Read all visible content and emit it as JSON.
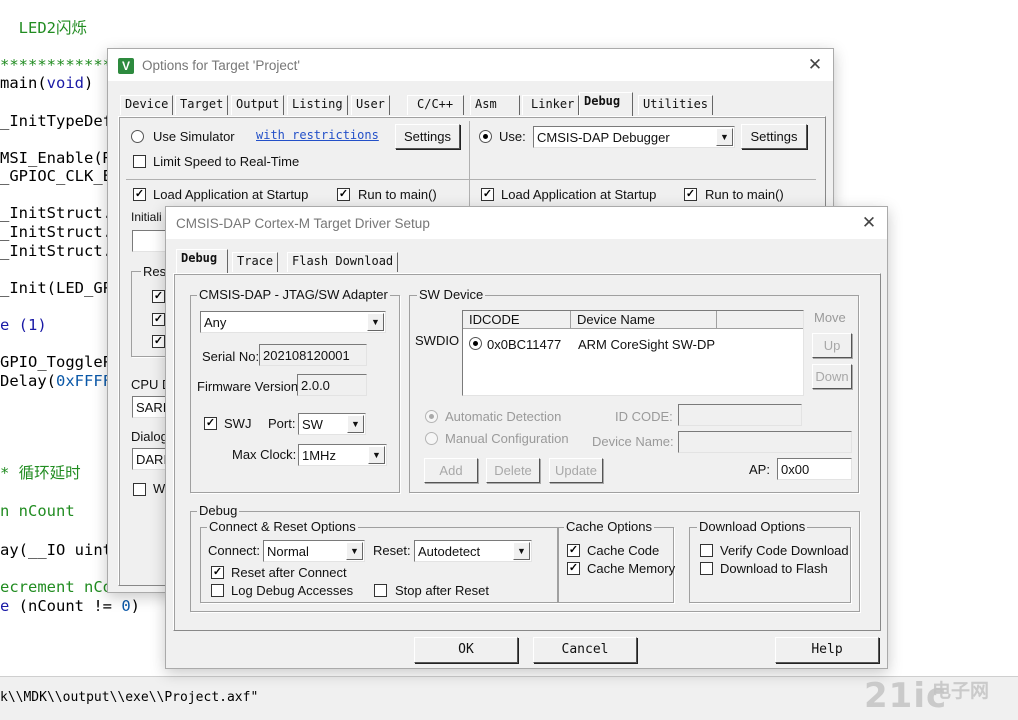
{
  "editor": {
    "lines": [
      {
        "parts": [
          {
            "t": "  LED2闪烁",
            "c": "cm"
          }
        ]
      },
      {
        "parts": [
          {
            "t": "***************",
            "c": "cm"
          }
        ]
      },
      {
        "parts": [
          {
            "t": "main(",
            "c": ""
          },
          {
            "t": "void",
            "c": "kw"
          },
          {
            "t": ")",
            "c": ""
          }
        ]
      },
      {
        "parts": [
          {
            "t": "_InitTypeDef",
            "c": ""
          }
        ]
      },
      {
        "parts": [
          {
            "t": "MSI_Enable(RC",
            "c": ""
          }
        ]
      },
      {
        "parts": [
          {
            "t": "_GPIOC_CLK_E",
            "c": ""
          }
        ]
      },
      {
        "parts": [
          {
            "t": "_InitStruct.F",
            "c": ""
          }
        ]
      },
      {
        "parts": [
          {
            "t": "_InitStruct.F",
            "c": ""
          }
        ]
      },
      {
        "parts": [
          {
            "t": "_InitStruct.F",
            "c": ""
          }
        ]
      },
      {
        "parts": [
          {
            "t": "_Init(LED_GP",
            "c": ""
          }
        ]
      },
      {
        "parts": [
          {
            "t": "e (1)",
            "c": "kw"
          }
        ]
      },
      {
        "parts": [
          {
            "t": "GPIO_TogglePi",
            "c": ""
          }
        ]
      },
      {
        "parts": [
          {
            "t": "Delay(",
            "c": ""
          },
          {
            "t": "0xFFFF",
            "c": "num"
          }
        ]
      },
      {
        "parts": [
          {
            "t": "* 循环延时",
            "c": "cm"
          }
        ]
      },
      {
        "parts": [
          {
            "t": "n nCount",
            "c": "cm"
          }
        ]
      },
      {
        "parts": [
          {
            "t": "ay(__IO uint",
            "c": ""
          }
        ]
      },
      {
        "parts": [
          {
            "t": "ecrement nCou",
            "c": "cm"
          }
        ]
      },
      {
        "parts": [
          {
            "t": "e",
            "c": "kw"
          },
          {
            "t": " (nCount != ",
            "c": ""
          },
          {
            "t": "0",
            "c": "num"
          },
          {
            "t": ")",
            "c": ""
          }
        ]
      }
    ],
    "output_line": "k\\\\MDK\\\\output\\\\exe\\\\Project.axf\""
  },
  "options_dialog": {
    "title": "Options for Target 'Project'",
    "close_glyph": "✕",
    "app_icon_letter": "V",
    "tabs": [
      "Device",
      "Target",
      "Output",
      "Listing",
      "User",
      "C/C++",
      "Asm",
      "Linker",
      "Debug",
      "Utilities"
    ],
    "selected_tab": "Debug",
    "use_simulator_label": "Use Simulator",
    "with_restrictions_link": "with restrictions",
    "settings_label": "Settings",
    "limit_speed_label": "Limit Speed to Real-Time",
    "use_label": "Use:",
    "debugger_value": "CMSIS-DAP Debugger",
    "load_app_label": "Load Application at Startup",
    "run_to_main_label": "Run to main()",
    "init_label": "Initiali",
    "restore_label": "Res",
    "cpu_label": "CPU D",
    "cpu_value": "SARI",
    "dialog_label": "Dialog",
    "dialog_value": "DARI",
    "w_label": "W"
  },
  "driver_dialog": {
    "title": "CMSIS-DAP Cortex-M Target Driver Setup",
    "close_glyph": "✕",
    "tabs": [
      "Debug",
      "Trace",
      "Flash Download"
    ],
    "selected_tab": "Debug",
    "adapter_group_label": "CMSIS-DAP - JTAG/SW Adapter",
    "adapter_value": "Any",
    "serial_label": "Serial No:",
    "serial_value": "202108120001",
    "firmware_label": "Firmware Version:",
    "firmware_value": "2.0.0",
    "swj_label": "SWJ",
    "port_label": "Port:",
    "port_value": "SW",
    "max_clock_label": "Max Clock:",
    "max_clock_value": "1MHz",
    "sw_device_group_label": "SW Device",
    "swdio_label": "SWDIO",
    "grid_headers": [
      "IDCODE",
      "Device Name"
    ],
    "grid_rows": [
      {
        "idcode": "0x0BC11477",
        "device_name": "ARM CoreSight SW-DP"
      }
    ],
    "move_label": "Move",
    "up_label": "Up",
    "down_label": "Down",
    "automatic_detection_label": "Automatic Detection",
    "manual_configuration_label": "Manual Configuration",
    "id_code_label": "ID CODE:",
    "device_name_label": "Device Name:",
    "add_label": "Add",
    "delete_label": "Delete",
    "update_label": "Update",
    "ap_label": "AP:",
    "ap_value": "0x00",
    "debug_group_label": "Debug",
    "connect_reset_group_label": "Connect & Reset Options",
    "connect_label": "Connect:",
    "connect_value": "Normal",
    "reset_label": "Reset:",
    "reset_value": "Autodetect",
    "reset_after_connect_label": "Reset after Connect",
    "log_debug_label": "Log Debug Accesses",
    "stop_after_reset_label": "Stop after Reset",
    "cache_group_label": "Cache Options",
    "cache_code_label": "Cache Code",
    "cache_memory_label": "Cache Memory",
    "download_group_label": "Download Options",
    "verify_code_label": "Verify Code Download",
    "download_flash_label": "Download to Flash",
    "ok_label": "OK",
    "cancel_label": "Cancel",
    "help_label": "Help",
    "check_glyph": "✓",
    "arrow_glyph": "▼"
  },
  "watermark": {
    "main": "21ic",
    "sub": "电子网"
  }
}
